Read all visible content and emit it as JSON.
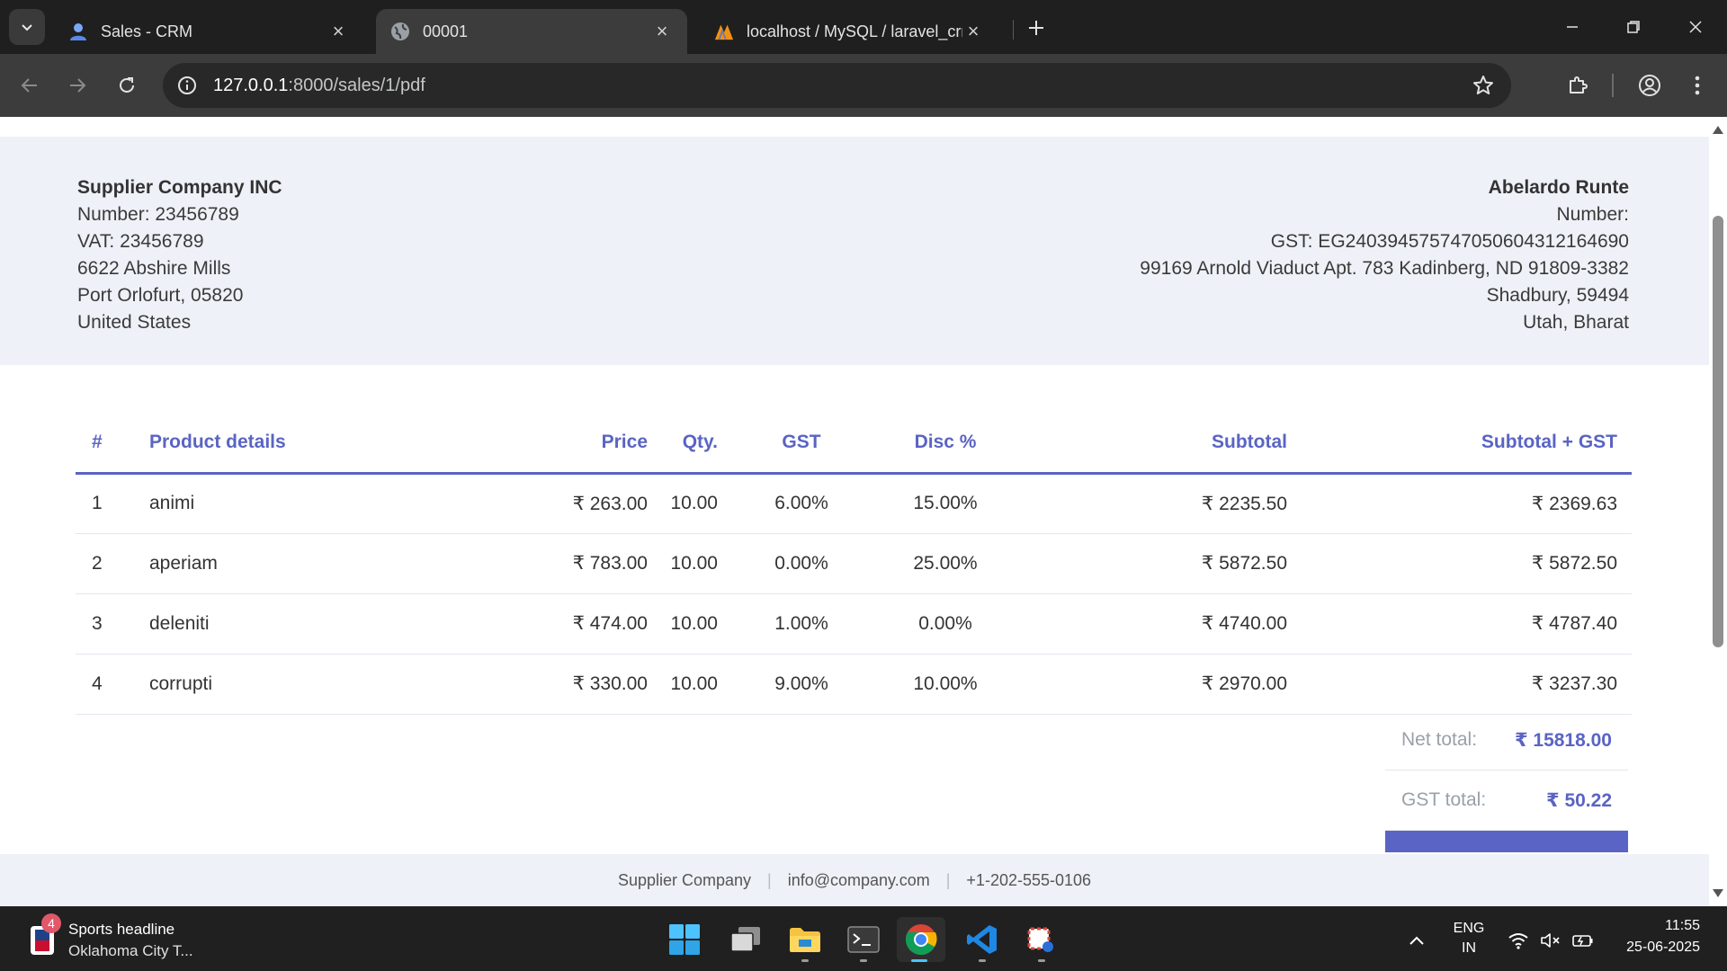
{
  "browser": {
    "tabs": [
      {
        "title": "Sales - CRM",
        "favicon": "user-icon",
        "active": false
      },
      {
        "title": "00001",
        "favicon": "globe-icon",
        "active": true
      },
      {
        "title": "localhost / MySQL / laravel_crm",
        "favicon": "phpmyadmin-icon",
        "active": false
      }
    ],
    "url_host": "127.0.0.1",
    "url_path": ":8000/sales/1/pdf"
  },
  "invoice": {
    "supplier": {
      "name": "Supplier Company INC",
      "number": "Number: 23456789",
      "vat": "VAT: 23456789",
      "address1": "6622 Abshire Mills",
      "address2": "Port Orlofurt, 05820",
      "country": "United States"
    },
    "customer": {
      "name": "Abelardo Runte",
      "number": "Number:",
      "gst": "GST: EG240394575747050604312164690",
      "address1": "99169 Arnold Viaduct Apt. 783 Kadinberg, ND 91809-3382",
      "address2": "Shadbury, 59494",
      "state": "Utah, Bharat"
    },
    "columns": {
      "idx": "#",
      "name": "Product details",
      "price": "Price",
      "qty": "Qty.",
      "gst": "GST",
      "disc": "Disc %",
      "sub": "Subtotal",
      "subgst": "Subtotal + GST"
    },
    "rows": [
      {
        "idx": "1",
        "name": "animi",
        "price": "₹ 263.00",
        "qty": "10.00",
        "gst": "6.00%",
        "disc": "15.00%",
        "sub": "₹ 2235.50",
        "subgst": "₹ 2369.63"
      },
      {
        "idx": "2",
        "name": "aperiam",
        "price": "₹ 783.00",
        "qty": "10.00",
        "gst": "0.00%",
        "disc": "25.00%",
        "sub": "₹ 5872.50",
        "subgst": "₹ 5872.50"
      },
      {
        "idx": "3",
        "name": "deleniti",
        "price": "₹ 474.00",
        "qty": "10.00",
        "gst": "1.00%",
        "disc": "0.00%",
        "sub": "₹ 4740.00",
        "subgst": "₹ 4787.40"
      },
      {
        "idx": "4",
        "name": "corrupti",
        "price": "₹ 330.00",
        "qty": "10.00",
        "gst": "9.00%",
        "disc": "10.00%",
        "sub": "₹ 2970.00",
        "subgst": "₹ 3237.30"
      }
    ],
    "totals": {
      "net_label": "Net total:",
      "net_value": "₹ 15818.00",
      "gst_label": "GST total:",
      "gst_value": "₹ 50.22"
    },
    "footer": {
      "company": "Supplier Company",
      "email": "info@company.com",
      "phone": "+1-202-555-0106"
    }
  },
  "taskbar": {
    "news_badge": "4",
    "news_title": "Sports headline",
    "news_sub": "Oklahoma City T...",
    "lang_top": "ENG",
    "lang_bottom": "IN",
    "time": "11:55",
    "date": "25-06-2025"
  },
  "colors": {
    "accent": "#5a64c4",
    "band": "#eef1f7",
    "chrome_dark": "#1f1f1f",
    "chrome_toolbar": "#3c3c3c"
  }
}
